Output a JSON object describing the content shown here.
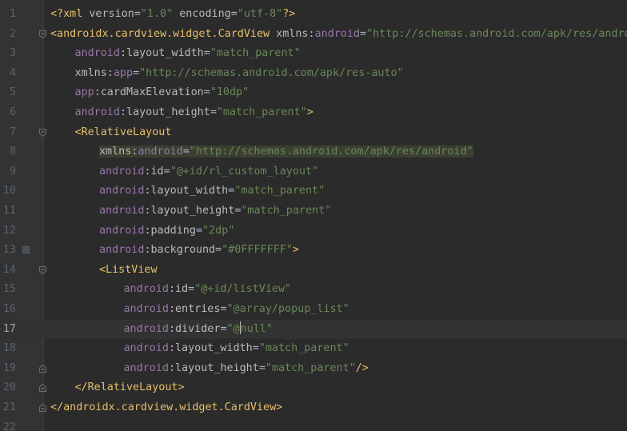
{
  "editor": {
    "lines": [
      {
        "num": "1",
        "indent": 0,
        "tokens": [
          {
            "t": "tag",
            "v": "<?xml "
          },
          {
            "t": "attr",
            "v": "version"
          },
          {
            "t": "plain",
            "v": "="
          },
          {
            "t": "str",
            "v": "\"1.0\""
          },
          {
            "t": "plain",
            "v": " "
          },
          {
            "t": "attr",
            "v": "encoding"
          },
          {
            "t": "plain",
            "v": "="
          },
          {
            "t": "str",
            "v": "\"utf-8\""
          },
          {
            "t": "tag",
            "v": "?>"
          }
        ]
      },
      {
        "num": "2",
        "indent": 0,
        "fold": "open",
        "tokens": [
          {
            "t": "tag",
            "v": "<androidx.cardview.widget.CardView "
          },
          {
            "t": "attr",
            "v": "xmlns:"
          },
          {
            "t": "ns",
            "v": "android"
          },
          {
            "t": "plain",
            "v": "="
          },
          {
            "t": "str",
            "v": "\"http://schemas.android.com/apk/res/android\""
          }
        ]
      },
      {
        "num": "3",
        "indent": 1,
        "tokens": [
          {
            "t": "ns",
            "v": "android"
          },
          {
            "t": "attr",
            "v": ":layout_width"
          },
          {
            "t": "plain",
            "v": "="
          },
          {
            "t": "str",
            "v": "\"match_parent\""
          }
        ]
      },
      {
        "num": "4",
        "indent": 1,
        "tokens": [
          {
            "t": "attr",
            "v": "xmlns:"
          },
          {
            "t": "ns",
            "v": "app"
          },
          {
            "t": "plain",
            "v": "="
          },
          {
            "t": "str",
            "v": "\"http://schemas.android.com/apk/res-auto\""
          }
        ]
      },
      {
        "num": "5",
        "indent": 1,
        "tokens": [
          {
            "t": "ns",
            "v": "app"
          },
          {
            "t": "attr",
            "v": ":cardMaxElevation"
          },
          {
            "t": "plain",
            "v": "="
          },
          {
            "t": "str",
            "v": "\"10dp\""
          }
        ]
      },
      {
        "num": "6",
        "indent": 1,
        "tokens": [
          {
            "t": "ns",
            "v": "android"
          },
          {
            "t": "attr",
            "v": ":layout_height"
          },
          {
            "t": "plain",
            "v": "="
          },
          {
            "t": "str",
            "v": "\"match_parent\""
          },
          {
            "t": "tag",
            "v": ">"
          }
        ]
      },
      {
        "num": "7",
        "indent": 1,
        "fold": "open",
        "tokens": [
          {
            "t": "tag",
            "v": "<RelativeLayout"
          }
        ]
      },
      {
        "num": "8",
        "indent": 2,
        "highlight": true,
        "tokens": [
          {
            "t": "attr",
            "v": "xmlns:"
          },
          {
            "t": "ns",
            "v": "android"
          },
          {
            "t": "plain",
            "v": "="
          },
          {
            "t": "str",
            "v": "\"http://schemas.android.com/apk/res/android\""
          }
        ]
      },
      {
        "num": "9",
        "indent": 2,
        "tokens": [
          {
            "t": "ns",
            "v": "android"
          },
          {
            "t": "attr",
            "v": ":id"
          },
          {
            "t": "plain",
            "v": "="
          },
          {
            "t": "str",
            "v": "\"@+id/rl_custom_layout\""
          }
        ]
      },
      {
        "num": "10",
        "indent": 2,
        "tokens": [
          {
            "t": "ns",
            "v": "android"
          },
          {
            "t": "attr",
            "v": ":layout_width"
          },
          {
            "t": "plain",
            "v": "="
          },
          {
            "t": "str",
            "v": "\"match_parent\""
          }
        ]
      },
      {
        "num": "11",
        "indent": 2,
        "tokens": [
          {
            "t": "ns",
            "v": "android"
          },
          {
            "t": "attr",
            "v": ":layout_height"
          },
          {
            "t": "plain",
            "v": "="
          },
          {
            "t": "str",
            "v": "\"match_parent\""
          }
        ]
      },
      {
        "num": "12",
        "indent": 2,
        "tokens": [
          {
            "t": "ns",
            "v": "android"
          },
          {
            "t": "attr",
            "v": ":padding"
          },
          {
            "t": "plain",
            "v": "="
          },
          {
            "t": "str",
            "v": "\"2dp\""
          }
        ]
      },
      {
        "num": "13",
        "indent": 2,
        "bookmark": true,
        "tokens": [
          {
            "t": "ns",
            "v": "android"
          },
          {
            "t": "attr",
            "v": ":background"
          },
          {
            "t": "plain",
            "v": "="
          },
          {
            "t": "str",
            "v": "\"#0FFFFFFF\""
          },
          {
            "t": "tag",
            "v": ">"
          }
        ]
      },
      {
        "num": "14",
        "indent": 2,
        "fold": "open",
        "tokens": [
          {
            "t": "tag",
            "v": "<ListView"
          }
        ]
      },
      {
        "num": "15",
        "indent": 3,
        "tokens": [
          {
            "t": "ns",
            "v": "android"
          },
          {
            "t": "attr",
            "v": ":id"
          },
          {
            "t": "plain",
            "v": "="
          },
          {
            "t": "str",
            "v": "\"@+id/listView\""
          }
        ]
      },
      {
        "num": "16",
        "indent": 3,
        "tokens": [
          {
            "t": "ns",
            "v": "android"
          },
          {
            "t": "attr",
            "v": ":entries"
          },
          {
            "t": "plain",
            "v": "="
          },
          {
            "t": "str",
            "v": "\"@array/popup_list\""
          }
        ]
      },
      {
        "num": "17",
        "indent": 3,
        "current": true,
        "tokens": [
          {
            "t": "ns",
            "v": "android"
          },
          {
            "t": "attr",
            "v": ":divider"
          },
          {
            "t": "plain",
            "v": "="
          },
          {
            "t": "str",
            "v": "\"@"
          },
          {
            "t": "caret",
            "v": ""
          },
          {
            "t": "str",
            "v": "null\""
          }
        ]
      },
      {
        "num": "18",
        "indent": 3,
        "tokens": [
          {
            "t": "ns",
            "v": "android"
          },
          {
            "t": "attr",
            "v": ":layout_width"
          },
          {
            "t": "plain",
            "v": "="
          },
          {
            "t": "str",
            "v": "\"match_parent\""
          }
        ]
      },
      {
        "num": "19",
        "indent": 3,
        "fold": "close",
        "tokens": [
          {
            "t": "ns",
            "v": "android"
          },
          {
            "t": "attr",
            "v": ":layout_height"
          },
          {
            "t": "plain",
            "v": "="
          },
          {
            "t": "str",
            "v": "\"match_parent\""
          },
          {
            "t": "tag",
            "v": "/>"
          }
        ]
      },
      {
        "num": "20",
        "indent": 1,
        "fold": "close",
        "tokens": [
          {
            "t": "tag",
            "v": "</RelativeLayout>"
          }
        ]
      },
      {
        "num": "21",
        "indent": 0,
        "fold": "close",
        "tokens": [
          {
            "t": "tag",
            "v": "</androidx.cardview.widget.CardView>"
          }
        ]
      },
      {
        "num": "22",
        "indent": 0,
        "tokens": []
      }
    ]
  }
}
